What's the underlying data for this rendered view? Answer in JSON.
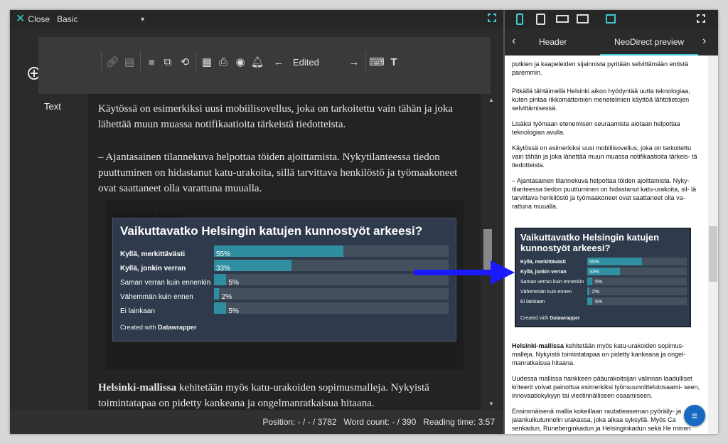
{
  "topbar": {
    "close_label": "Close",
    "mode_label": "Basic"
  },
  "toolbar": {
    "edited_label": "Edited"
  },
  "sidebar": {
    "section_label": "Text"
  },
  "article": {
    "p1": "Käytössä on esimerkiksi uusi mobiilisovellus, joka on tarkoitettu vain tähän ja joka lähettää muun muassa notifikaatioita tärkeistä tiedotteista.",
    "p2": "– Ajantasainen tilannekuva helpottaa töiden ajoittamista. Nykytilanteessa tiedon puuttuminen on hidastanut katu-urakoita, sillä tarvittava henkilöstö ja työmaakoneet ovat saattaneet olla varattuna muualla.",
    "embed_heading": "Tuoreimmat tulokset",
    "p3_bold": "Helsinki-mallissa",
    "p3_rest": " kehitetään myös katu-urakoiden sopimusmalleja. Nykyistä toimintatapaa on pidetty kankeana ja ongelmanratkaisua hitaana."
  },
  "chart_data": {
    "type": "bar",
    "title": "Vaikuttavatko Helsingin katujen kunnostyöt arkeesi?",
    "categories": [
      "Kyllä, merkittävästi",
      "Kyllä, jonkin verran",
      "Saman verran kuin ennenkin",
      "Vähemmän kuin ennen",
      "Ei lainkaan"
    ],
    "values": [
      55,
      33,
      5,
      2,
      5
    ],
    "value_labels": [
      "55%",
      "33%",
      "5%",
      "2%",
      "5%"
    ],
    "bold_categories": [
      true,
      true,
      false,
      false,
      false
    ],
    "ylim": [
      0,
      100
    ],
    "footer_prefix": "Created with ",
    "footer_brand": "Datawrapper",
    "colors": {
      "bar": "#2f8ea0",
      "track": "#45505f",
      "background": "#2f3b4c"
    }
  },
  "status": {
    "position": "Position: - / - / 3782",
    "word_count": "Word count: - / 390",
    "reading_time": "Reading time: 3:57"
  },
  "preview": {
    "tabs": [
      "Header",
      "NeoDirect preview"
    ],
    "p0": "putkien ja kaapeleiden sijainnista pyritään selvittämään entistä paremmin.",
    "p1": "Pitkällä tähtäimellä Helsinki aikoo hyödyntää uutta teknologiaa, kuten pintaa rikkomattomien menetelmien käyttöä lähtötietojen selvittämisessä.",
    "p2": "Lisäksi työmaan etenemisen seuraamista aiotaan helpottaa teknologian avulla.",
    "p3": "Käytössä on esimerkiksi uusi mobiilisovellus, joka on tarkoitettu vain tähän ja joka lähettää muun muassa notifikaatioita tärkeis- tä tiedotteista.",
    "p4": "– Ajantasainen tilannekuva helpottaa töiden ajoittamista. Nyky- tilanteessa tiedon puuttuminen on hidastanut katu-urakoita, sil- lä tarvittava henkilöstö ja työmaakoneet ovat saattaneet olla va- rattuna muualla.",
    "p5_bold": "Helsinki-mallissa",
    "p5_rest": " kehitetään myös katu-urakoiden sopimus- malleja. Nykyistä toimintatapaa on pidetty kankeana ja ongel- manratkaisua hitaana.",
    "p6": "Uudessa mallissa hankkeen pääurakoitsijan valinnan laadulliset kriteerit voivat painottua esimerkiksi työnsuunnittelutosaami- seen, innovaatiokykyyn tai viestinnälliseen osaamiseen.",
    "p7": "Ensimmäisenä mallia kokeillaan rautatieaseman pyöräily- ja jalankulkutunnelin urakassa, joka alkaa syksyllä. Myös Ca senkadun, Runeberginkadun ja Helsinginkadun sekä He mmen yritysalueen katu-urakka ovat testikohteita."
  }
}
